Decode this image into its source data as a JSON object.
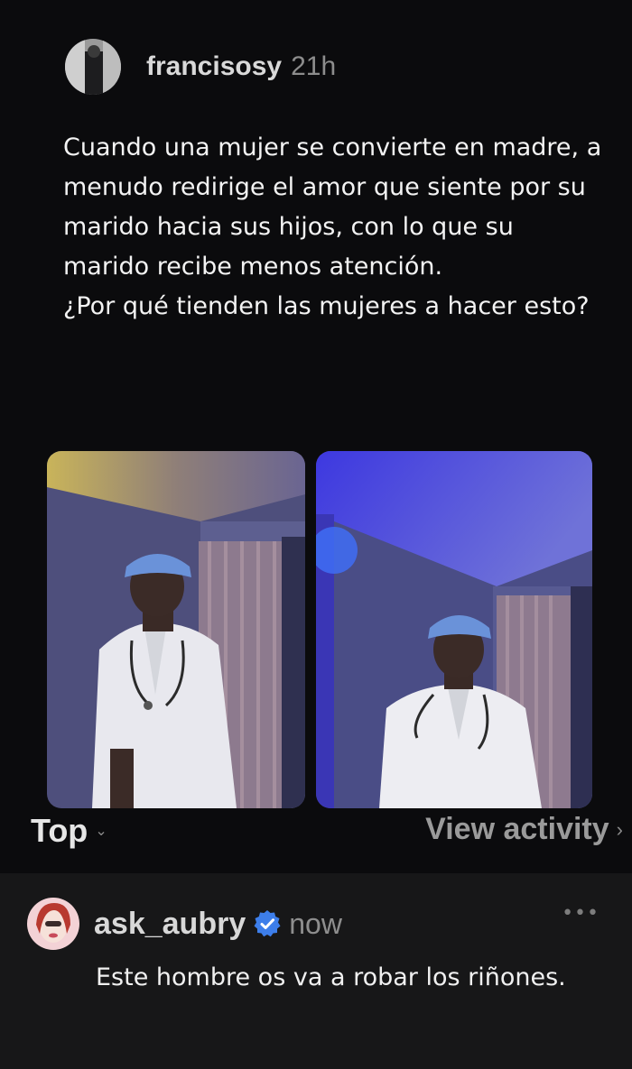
{
  "post": {
    "username": "francisosy",
    "time": "21h",
    "text_lines": [
      "Cuando una mujer se convierte en madre, a menudo redirige el amor que siente por su marido hacia sus hijos, con lo que su marido recibe menos atención.",
      "¿Por qué tienden las mujeres a hacer esto?"
    ]
  },
  "toolbar": {
    "sort_label": "Top",
    "sort_chevron": "chevron-down-icon",
    "activity_label": "View activity",
    "activity_chevron": "chevron-right-icon"
  },
  "reply": {
    "username": "ask_aubry",
    "verified_icon": "verified-badge-icon",
    "time": "now",
    "more_icon": "more-icon",
    "text": "Este hombre os va a robar los riñones."
  },
  "colors": {
    "background": "#0b0b0d",
    "reply_background": "#171718",
    "verified": "#3d7eea"
  }
}
